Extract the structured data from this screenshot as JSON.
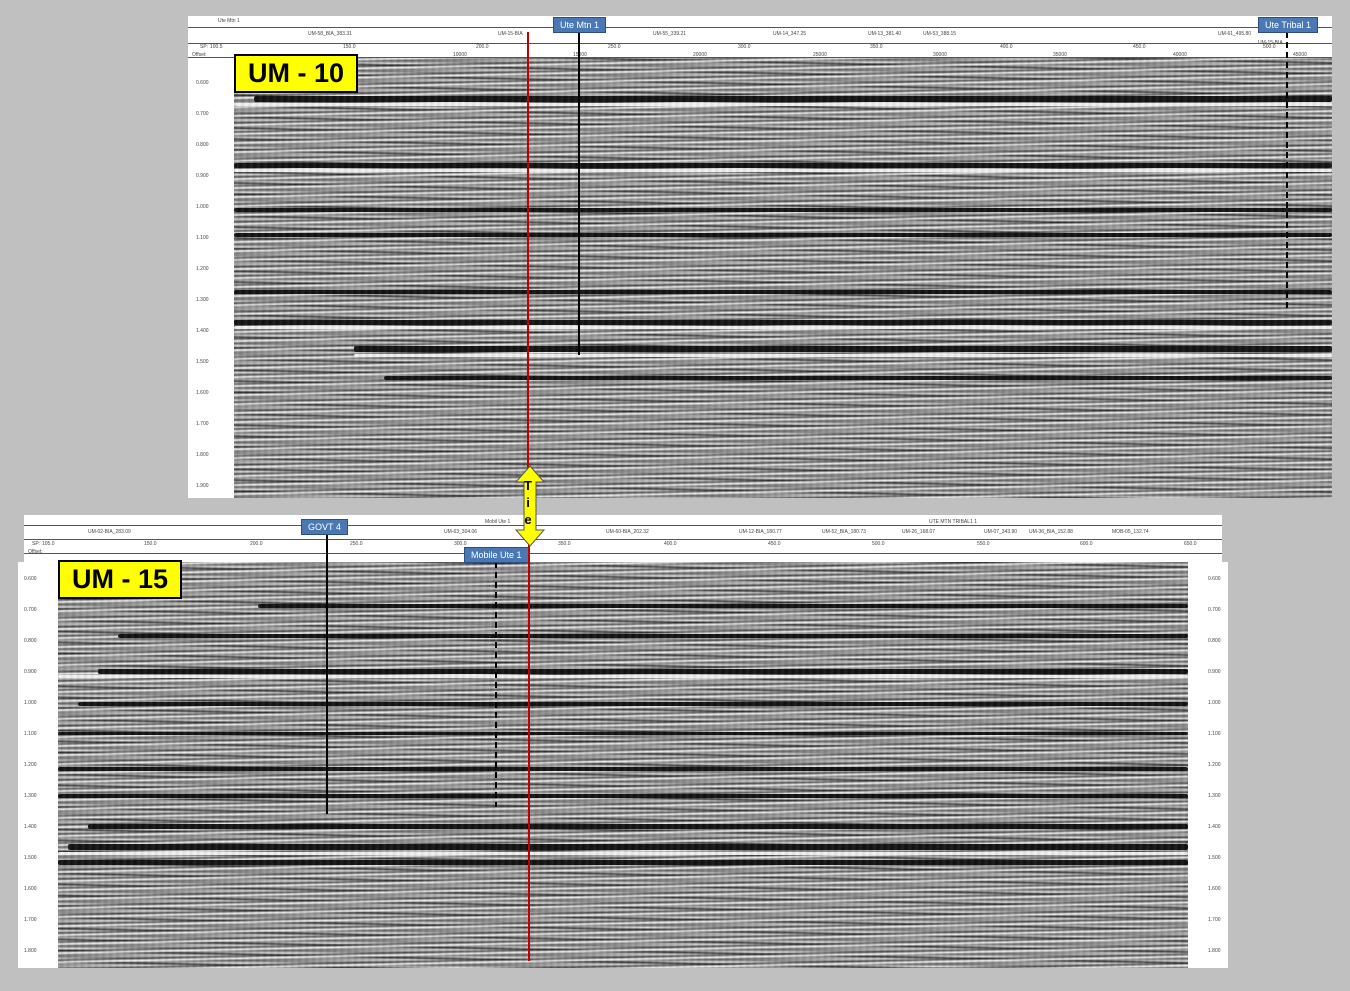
{
  "top_section": {
    "label": "UM - 10",
    "wells": [
      {
        "name": "Ute Mtn 1",
        "style": "solid"
      },
      {
        "name": "Ute Tribal 1",
        "style": "dashed"
      }
    ],
    "header_lines": [
      "Ute Mtn 1",
      "UM-58_BIA_383.31",
      "UM-15-BIA",
      "UM-55_339.21",
      "UM-14_347.25",
      "UM-13_381.40",
      "UM-53_388.15",
      "UM-61_495.80",
      "UM-15-BIA"
    ],
    "sp_ticks": [
      "150.0",
      "200.0",
      "250.0",
      "300.0",
      "350.0",
      "400.0",
      "450.0",
      "500.0"
    ],
    "offset_ticks": [
      "10000",
      "15000",
      "20000",
      "25000",
      "30000",
      "35000",
      "40000",
      "45000"
    ],
    "time_ticks": [
      "0.600",
      "0.700",
      "0.800",
      "0.900",
      "1.000",
      "1.100",
      "1.200",
      "1.300",
      "1.400",
      "1.500",
      "1.600",
      "1.700",
      "1.800",
      "1.900"
    ],
    "sp_label": "SP:",
    "offset_label": "Offset:",
    "sp_start": "100.5"
  },
  "bottom_section": {
    "label": "UM - 15",
    "wells": [
      {
        "name": "GOVT 4",
        "style": "solid"
      },
      {
        "name": "Mobile Ute 1",
        "style": "dashed"
      }
    ],
    "header_lines": [
      "UM-02-BIA_283.09",
      "UM-63_304.06",
      "Mobil Ute 1",
      "UM-60-BIA_202.32",
      "UM-12-BIA_180.77",
      "UM-52_BIA_180.73",
      "UM-26_168.07",
      "UTE MTN TRIBAL1 1",
      "UM-07_343.90",
      "UM-36_BIA_152.88",
      "MOB-05_132.74"
    ],
    "sp_ticks": [
      "150.0",
      "200.0",
      "250.0",
      "300.0",
      "350.0",
      "400.0",
      "450.0",
      "500.0",
      "550.0",
      "600.0",
      "650.0"
    ],
    "time_ticks": [
      "0.600",
      "0.700",
      "0.800",
      "0.900",
      "1.000",
      "1.100",
      "1.200",
      "1.300",
      "1.400",
      "1.500",
      "1.600",
      "1.700",
      "1.800"
    ],
    "sp_label": "SP:",
    "offset_label": "Offset:",
    "sp_start": "105.0"
  },
  "tie": {
    "letters": [
      "T",
      "i",
      "e"
    ],
    "arrow_color": "#ffff00",
    "line_color": "#c00000"
  },
  "colors": {
    "background": "#c0c0c0",
    "label_bg": "#ffff00",
    "well_tag_bg": "#4a78b5"
  }
}
